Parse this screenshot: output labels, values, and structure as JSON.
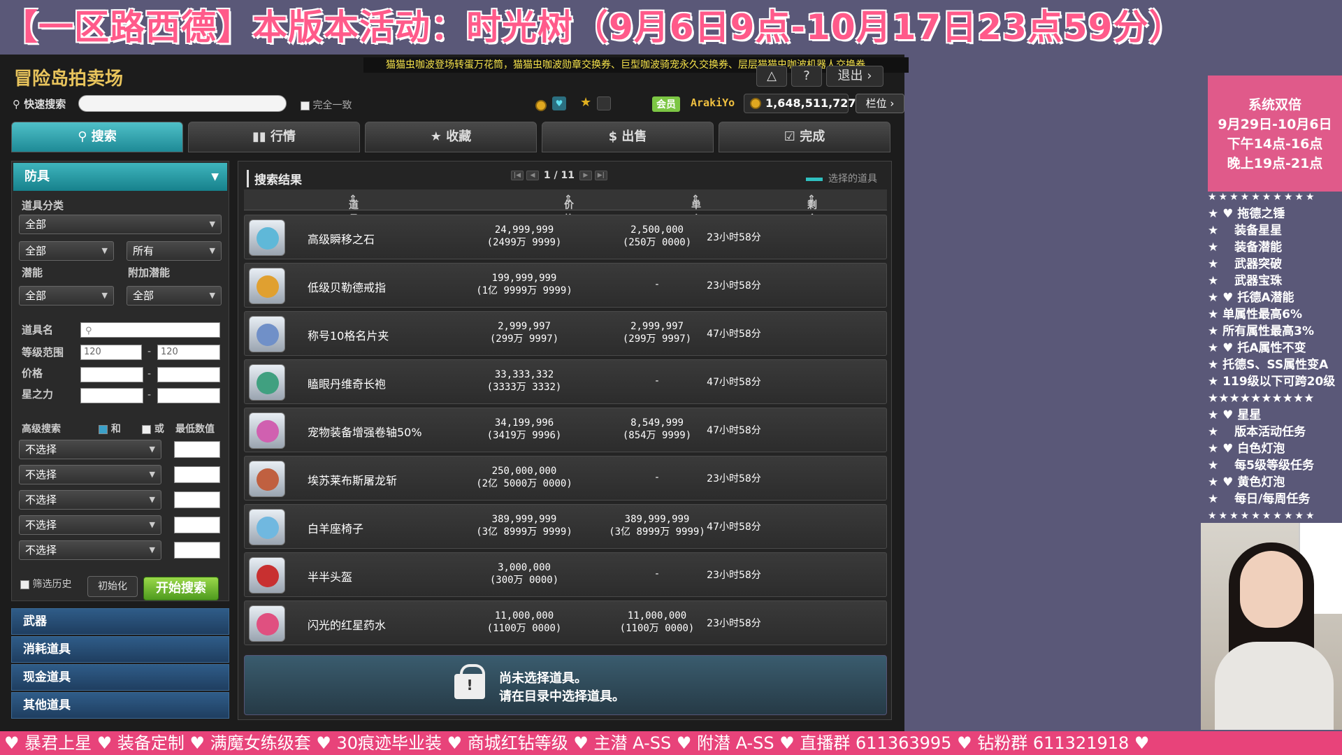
{
  "banner": {
    "title": "【一区路西德】本版本活动：时光树（9月6日9点-10月17日23点59分）"
  },
  "marquee": {
    "text": "猫猫虫咖波登场转蛋万花筒，猫猫虫咖波勋章交换券、巨型咖波骑宠永久交换券、层层猫猫虫咖波机器人交换券"
  },
  "auction": {
    "title": "冒险岛拍卖场",
    "top_buttons": [
      "△",
      "?",
      "退出 ›"
    ],
    "quick_search_label": "快速搜索",
    "quick_search_value": "",
    "exact_match_label": "完全一致",
    "vip_badge": "会员",
    "username": "ArakiYo",
    "mesos": "1,648,511,727",
    "slot_button": "栏位 ›"
  },
  "tabs": [
    {
      "label": "搜索",
      "icon": "search-icon",
      "active": true
    },
    {
      "label": "行情",
      "icon": "chart-icon",
      "active": false
    },
    {
      "label": "收藏",
      "icon": "star-icon",
      "active": false
    },
    {
      "label": "出售",
      "icon": "dollar-icon",
      "active": false
    },
    {
      "label": "完成",
      "icon": "check-icon",
      "active": false
    }
  ],
  "filters": {
    "category_header": "防具",
    "item_class_label": "道具分类",
    "item_class_value": "全部",
    "sub_class_1": "全部",
    "sub_class_2": "所有",
    "potential_label": "潜能",
    "bonus_potential_label": "附加潜能",
    "potential_value": "全部",
    "bonus_potential_value": "全部",
    "item_name_label": "道具名",
    "level_range_label": "等级范围",
    "level_min": "120",
    "level_max": "120",
    "price_label": "价格",
    "starforce_label": "星之力",
    "advanced_label": "高级搜索",
    "and_label": "和",
    "or_label": "或",
    "min_value_label": "最低数值",
    "advanced_options": [
      "不选择",
      "不选择",
      "不选择",
      "不选择",
      "不选择"
    ],
    "history_label": "筛选历史",
    "reset_label": "初始化",
    "start_label": "开始搜索"
  },
  "categories": [
    "武器",
    "消耗道具",
    "现金道具",
    "其他道具"
  ],
  "results": {
    "title": "搜索结果",
    "page_current": "1",
    "page_total": "11",
    "legend_label": "选择的道具",
    "columns": [
      "道具名称",
      "价格",
      "单个价格",
      "剩余时间"
    ],
    "rows": [
      {
        "name": "高级瞬移之石",
        "price": "24,999,999",
        "price_cn": "(2499万 9999)",
        "unit": "2,500,000",
        "unit_cn": "(250万 0000)",
        "time": "23小时58分",
        "color": "#5fb8d8"
      },
      {
        "name": "低级贝勒德戒指",
        "price": "199,999,999",
        "price_cn": "(1亿 9999万 9999)",
        "unit": "-",
        "unit_cn": "",
        "time": "23小时58分",
        "color": "#e0a030"
      },
      {
        "name": "称号10格名片夹",
        "price": "2,999,997",
        "price_cn": "(299万 9997)",
        "unit": "2,999,997",
        "unit_cn": "(299万 9997)",
        "time": "47小时58分",
        "color": "#7090c8"
      },
      {
        "name": "瞌眼丹维奇长袍",
        "price": "33,333,332",
        "price_cn": "(3333万 3332)",
        "unit": "-",
        "unit_cn": "",
        "time": "47小时58分",
        "color": "#40a080"
      },
      {
        "name": "宠物装备增强卷轴50%",
        "price": "34,199,996",
        "price_cn": "(3419万 9996)",
        "unit": "8,549,999",
        "unit_cn": "(854万 9999)",
        "time": "47小时58分",
        "color": "#d060b0"
      },
      {
        "name": "埃苏莱布斯屠龙斩",
        "price": "250,000,000",
        "price_cn": "(2亿 5000万 0000)",
        "unit": "-",
        "unit_cn": "",
        "time": "23小时58分",
        "color": "#c06040"
      },
      {
        "name": "白羊座椅子",
        "price": "389,999,999",
        "price_cn": "(3亿 8999万 9999)",
        "unit": "389,999,999",
        "unit_cn": "(3亿 8999万 9999)",
        "time": "47小时58分",
        "color": "#70b8e0"
      },
      {
        "name": "半半头盔",
        "price": "3,000,000",
        "price_cn": "(300万 0000)",
        "unit": "-",
        "unit_cn": "",
        "time": "23小时58分",
        "color": "#c83030"
      },
      {
        "name": "闪光的红星药水",
        "price": "11,000,000",
        "price_cn": "(1100万 0000)",
        "unit": "11,000,000",
        "unit_cn": "(1100万 0000)",
        "time": "23小时58分",
        "color": "#e05080"
      }
    ],
    "notice_line1": "尚未选择道具。",
    "notice_line2": "请在目录中选择道具。"
  },
  "side_box": [
    "系统双倍",
    "9月29日-10月6日",
    "下午14点-16点",
    "晚上19点-21点"
  ],
  "stars_line": "★★★★★★★★★★",
  "side_list": [
    "★ ♥ 拖德之锤",
    "★ 　装备星星",
    "★ 　装备潜能",
    "★ 　武器突破",
    "★ 　武器宝珠",
    "★ ♥ 托德A潜能",
    "★ 单属性最高6%",
    "★ 所有属性最高3%",
    "★ ♥ 托A属性不变",
    "★ 托德S、SS属性变A",
    "★ 119级以下可跨20级",
    "★★★★★★★★★★",
    "★ ♥ 星星",
    "★ 　版本活动任务",
    "★ ♥ 白色灯泡",
    "★ 　每5级等级任务",
    "★ ♥ 黄色灯泡",
    "★ 　每日/每周任务"
  ],
  "bottom_bar": "♥ 暴君上星 ♥ 装备定制 ♥ 满魔女练级套 ♥ 30痕迹毕业装 ♥ 商城红钻等级 ♥ 主潜 A-SS ♥ 附潜 A-SS ♥ 直播群 611363995 ♥ 钻粉群 611321918 ♥",
  "colors": {
    "accent": "#2fa8b4",
    "banner": "#ff5a8a",
    "bottom_bar": "#e8437a",
    "start_button": "#7cc644"
  }
}
